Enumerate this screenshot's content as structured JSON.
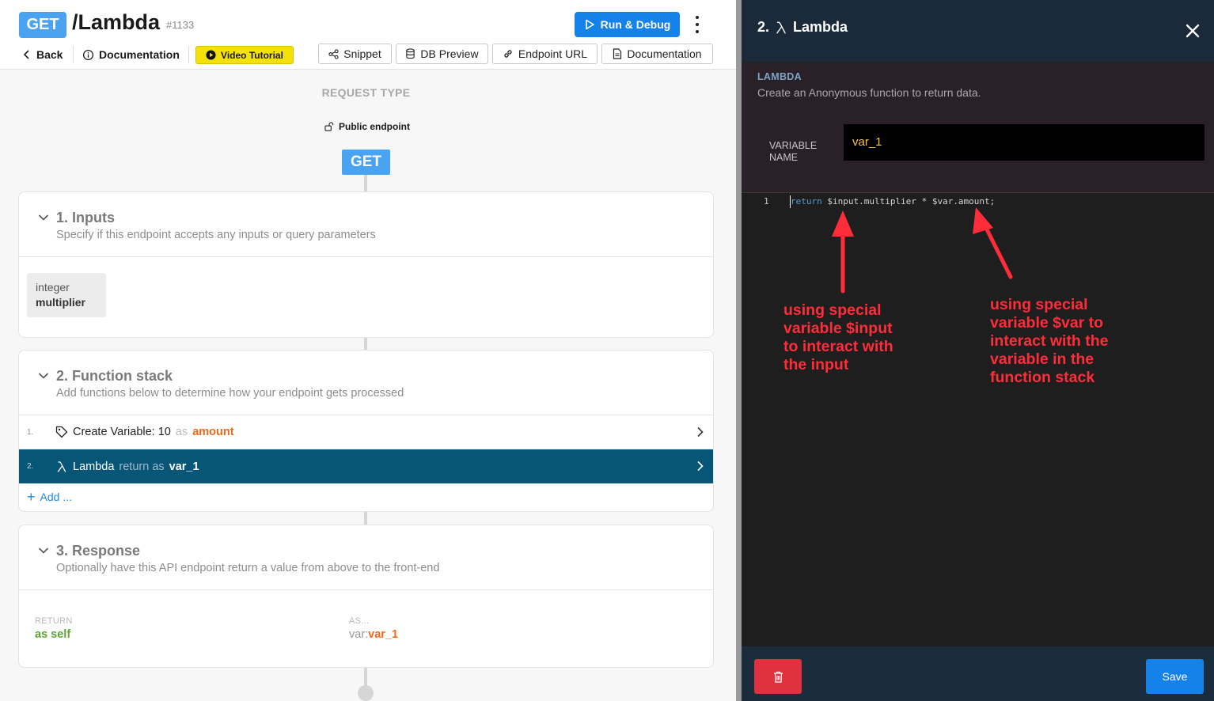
{
  "header": {
    "method": "GET",
    "path": "/Lambda",
    "id": "#1133",
    "run_label": "Run & Debug",
    "back_label": "Back",
    "doc_label": "Documentation",
    "video_label": "Video Tutorial",
    "tools": [
      "Snippet",
      "DB Preview",
      "Endpoint URL",
      "Documentation"
    ]
  },
  "request": {
    "label": "REQUEST TYPE",
    "visibility": "Public endpoint",
    "method": "GET"
  },
  "inputs": {
    "title": "1. Inputs",
    "desc": "Specify if this endpoint accepts any inputs or query parameters",
    "items": [
      {
        "type": "integer",
        "name": "multiplier"
      }
    ]
  },
  "stack": {
    "title": "2. Function stack",
    "desc": "Add functions below to determine how your endpoint gets processed",
    "rows": [
      {
        "num": "1.",
        "label": "Create Variable: 10",
        "as": "as",
        "var": "amount"
      },
      {
        "num": "2.",
        "label": "Lambda",
        "as": "return as",
        "var": "var_1"
      }
    ],
    "add_label": "Add ..."
  },
  "response": {
    "title": "3. Response",
    "desc": "Optionally have this API endpoint return a value from above to the front-end",
    "return_label": "RETURN",
    "return_value": "as self",
    "as_label": "AS...",
    "as_prefix": "var:",
    "as_value": "var_1"
  },
  "panel": {
    "title_num": "2.",
    "title": "Lambda",
    "section_label": "LAMBDA",
    "section_desc": "Create an Anonymous function to return data.",
    "var_label": "VARIABLE NAME",
    "var_value": "var_1",
    "line_number": "1",
    "code_keyword": "return",
    "code_rest": " $input.multiplier * $var.amount;",
    "annotations": [
      "using special variable $input to interact with the input",
      "using special variable $var to interact with the variable in the function stack"
    ],
    "save_label": "Save"
  },
  "colors": {
    "accent": "#1482e8",
    "method_badge": "#4aa3f0",
    "active_row": "#075678",
    "var_orange": "#ea6a1e",
    "green": "#5aa832",
    "annotation_red": "#ff2d3a",
    "delete_red": "#e0313f"
  }
}
